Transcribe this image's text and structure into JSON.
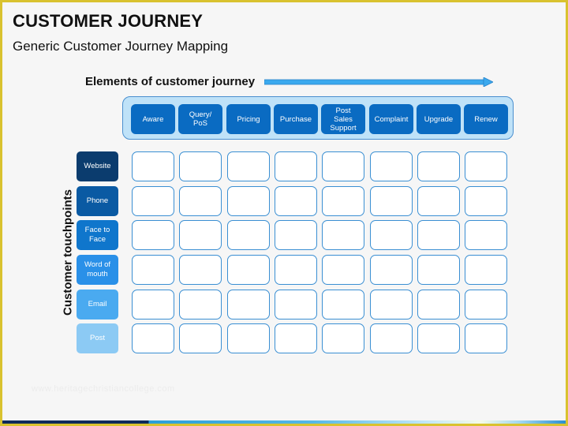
{
  "header": {
    "title": "CUSTOMER JOURNEY",
    "subtitle": "Generic Customer Journey Mapping"
  },
  "diagram": {
    "elements_label": "Elements of customer journey",
    "touchpoints_label": "Customer touchpoints",
    "arrow_color": "#3ba9ee",
    "stage_color": "#0a6bc2",
    "stage_container_color": "#bfe2f8",
    "cell_border_color": "#3a8fd3",
    "stages": [
      {
        "label": "Aware"
      },
      {
        "label": "Query/\nPoS"
      },
      {
        "label": "Pricing"
      },
      {
        "label": "Purchase"
      },
      {
        "label": "Post\nSales\nSupport"
      },
      {
        "label": "Complaint"
      },
      {
        "label": "Upgrade"
      },
      {
        "label": "Renew"
      }
    ],
    "touchpoints": [
      {
        "label": "Website",
        "color": "#0b3c6e"
      },
      {
        "label": "Phone",
        "color": "#0a5aa3"
      },
      {
        "label": "Face to\nFace",
        "color": "#0f76cc"
      },
      {
        "label": "Word of\nmouth",
        "color": "#2a90e8"
      },
      {
        "label": "Email",
        "color": "#4aaaf0"
      },
      {
        "label": "Post",
        "color": "#8ccaf4"
      }
    ]
  },
  "footer": {
    "watermark": "www.heritagechristiancollege.com"
  }
}
